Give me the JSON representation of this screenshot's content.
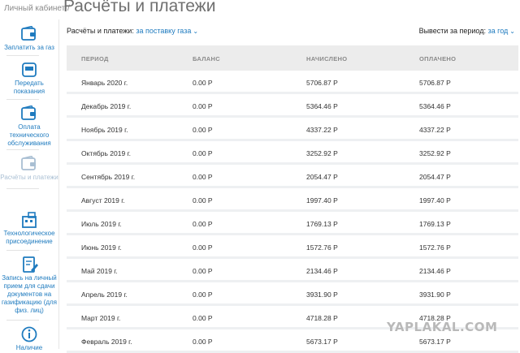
{
  "breadcrumb": "Личный кабинет /",
  "page_title": "Расчёты и платежи",
  "sidebar": {
    "items": [
      {
        "label": "Заплатить за газ",
        "icon": "wallet-icon"
      },
      {
        "label": "Передать показания",
        "icon": "meter-icon"
      },
      {
        "label": "Оплата технического обслуживания",
        "icon": "wallet-icon"
      },
      {
        "label": "Расчёты и платежи",
        "icon": "wallet-icon",
        "active": true
      },
      {
        "label": "Технологическое присоединение",
        "icon": "building-icon"
      },
      {
        "label": "Запись на личный прием для сдачи документов на газификацию (для физ. лиц)",
        "icon": "document-edit-icon"
      },
      {
        "label": "Наличие",
        "icon": "info-icon"
      }
    ]
  },
  "filter": {
    "label": "Расчёты и платежи:",
    "value": "за поставку газа"
  },
  "period": {
    "label": "Вывести за период:",
    "value": "за год"
  },
  "table": {
    "headers": [
      "ПЕРИОД",
      "БАЛАНС",
      "НАЧИСЛЕНО",
      "ОПЛАЧЕНО"
    ],
    "rows": [
      [
        "Январь 2020 г.",
        "0.00 Р",
        "5706.87 Р",
        "5706.87 Р"
      ],
      [
        "Декабрь 2019 г.",
        "0.00 Р",
        "5364.46 Р",
        "5364.46 Р"
      ],
      [
        "Ноябрь 2019 г.",
        "0.00 Р",
        "4337.22 Р",
        "4337.22 Р"
      ],
      [
        "Октябрь 2019 г.",
        "0.00 Р",
        "3252.92 Р",
        "3252.92 Р"
      ],
      [
        "Сентябрь 2019 г.",
        "0.00 Р",
        "2054.47 Р",
        "2054.47 Р"
      ],
      [
        "Август 2019 г.",
        "0.00 Р",
        "1997.40 Р",
        "1997.40 Р"
      ],
      [
        "Июль 2019 г.",
        "0.00 Р",
        "1769.13 Р",
        "1769.13 Р"
      ],
      [
        "Июнь 2019 г.",
        "0.00 Р",
        "1572.76 Р",
        "1572.76 Р"
      ],
      [
        "Май 2019 г.",
        "0.00 Р",
        "2134.46 Р",
        "2134.46 Р"
      ],
      [
        "Апрель 2019 г.",
        "0.00 Р",
        "3931.90 Р",
        "3931.90 Р"
      ],
      [
        "Март 2019 г.",
        "0.00 Р",
        "4718.28 Р",
        "4718.28 Р"
      ],
      [
        "Февраль 2019 г.",
        "0.00 Р",
        "5673.17 Р",
        "5673.17 Р"
      ]
    ]
  },
  "watermark": "YAPLAKAL.COM",
  "colors": {
    "accent": "#1f7bbf",
    "inactive": "#a9bfd3",
    "header_bg": "#ececec"
  }
}
